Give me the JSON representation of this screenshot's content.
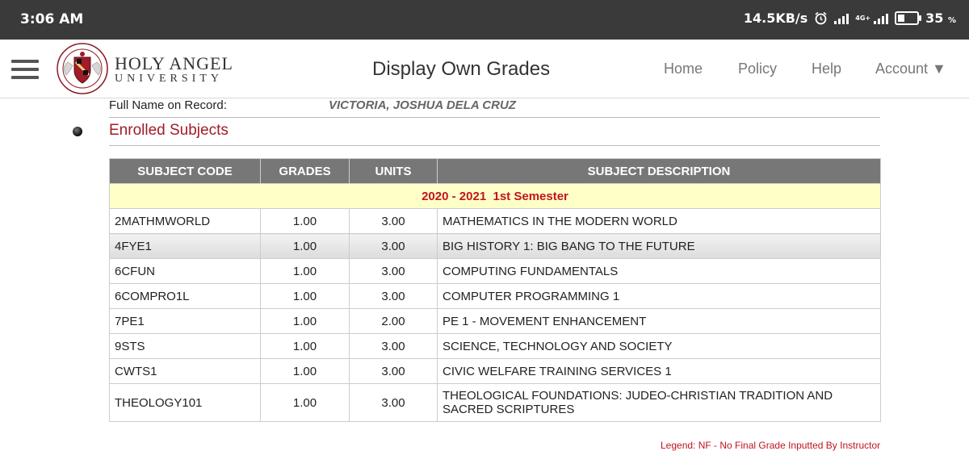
{
  "status_bar": {
    "time": "3:06 AM",
    "speed": "14.5KB/s",
    "network": "4G+",
    "battery_level": 0.35,
    "battery_text": "35",
    "battery_unit": "%"
  },
  "header": {
    "university_line1": "HOLY ANGEL",
    "university_line2": "UNIVERSITY",
    "page_title": "Display Own Grades",
    "nav": [
      "Home",
      "Policy",
      "Help",
      "Account ▼"
    ]
  },
  "record": {
    "label": "Full Name on Record:",
    "name": "VICTORIA, JOSHUA DELA CRUZ"
  },
  "section_title": "Enrolled Subjects",
  "table": {
    "headers": [
      "SUBJECT CODE",
      "GRADES",
      "UNITS",
      "SUBJECT DESCRIPTION"
    ],
    "semester": "2020 - 2021  1st Semester",
    "rows": [
      {
        "code": "2MATHMWORLD",
        "grade": "1.00",
        "units": "3.00",
        "desc": "MATHEMATICS IN THE MODERN WORLD"
      },
      {
        "code": "4FYE1",
        "grade": "1.00",
        "units": "3.00",
        "desc": "BIG HISTORY 1: BIG BANG TO THE FUTURE"
      },
      {
        "code": "6CFUN",
        "grade": "1.00",
        "units": "3.00",
        "desc": "COMPUTING FUNDAMENTALS"
      },
      {
        "code": "6COMPRO1L",
        "grade": "1.00",
        "units": "3.00",
        "desc": "COMPUTER PROGRAMMING 1"
      },
      {
        "code": "7PE1",
        "grade": "1.00",
        "units": "2.00",
        "desc": "PE 1 - MOVEMENT ENHANCEMENT"
      },
      {
        "code": "9STS",
        "grade": "1.00",
        "units": "3.00",
        "desc": "SCIENCE, TECHNOLOGY AND SOCIETY"
      },
      {
        "code": "CWTS1",
        "grade": "1.00",
        "units": "3.00",
        "desc": "CIVIC WELFARE TRAINING SERVICES 1"
      },
      {
        "code": "THEOLOGY101",
        "grade": "1.00",
        "units": "3.00",
        "desc": "THEOLOGICAL FOUNDATIONS: JUDEO-CHRISTIAN TRADITION AND SACRED SCRIPTURES"
      }
    ]
  },
  "legend": "Legend: NF - No Final Grade Inputted By Instructor",
  "colors": {
    "accent": "#a01c28",
    "header_bg": "#777777",
    "semester_bg": "#ffffc8"
  },
  "icons": {
    "menu": "hamburger-icon",
    "alarm": "alarm-icon",
    "signal": "signal-icon",
    "battery": "battery-icon"
  }
}
